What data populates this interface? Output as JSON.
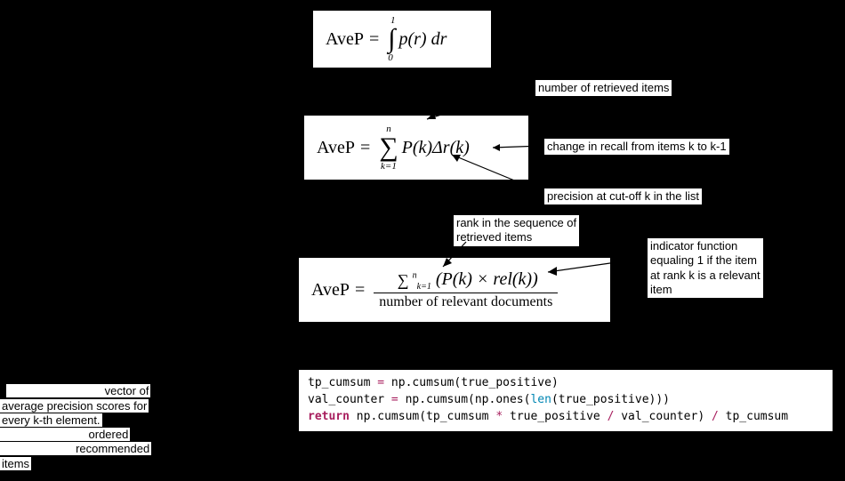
{
  "formulas": {
    "f1_label": "AveP",
    "f1_eq": "=",
    "f1_int_top": "1",
    "f1_int_bot": "0",
    "f1_body": "p(r) dr",
    "f2_label": "AveP",
    "f2_eq": "=",
    "f2_sum_top": "n",
    "f2_sum_bot": "k=1",
    "f2_body": "P(k)Δr(k)",
    "f3_label": "AveP",
    "f3_eq": "=",
    "f3_num_sum_top": "n",
    "f3_num_sum_bot": "k=1",
    "f3_num_rest": "(P(k) × rel(k))",
    "f3_den": "number of relevant documents"
  },
  "annotations": {
    "a1": "number of retrieved items",
    "a2": "change in recall from items k to k-1",
    "a3": "precision at cut-off k in the list",
    "a4": "rank in the sequence of\nretrieved items",
    "a5": "indicator function\nequaling 1 if the item\nat rank k is a relevant\nitem"
  },
  "hidden_text": {
    "left_block": "vector of\naverage precision scores for\nevery k-th element.\nordered\nrecommended\nitems"
  },
  "code": {
    "line1_a": "tp_cumsum ",
    "line1_op": "=",
    "line1_b": " np.cumsum(true_positive)",
    "line2_a": "val_counter ",
    "line2_op": "=",
    "line2_b": " np.cumsum(np.ones(",
    "line2_len": "len",
    "line2_c": "(true_positive)))",
    "line3_ret": "return",
    "line3_a": " np.cumsum(tp_cumsum ",
    "line3_op1": "*",
    "line3_b": " true_positive ",
    "line3_op2": "/",
    "line3_c": " val_counter) ",
    "line3_op3": "/",
    "line3_d": " tp_cumsum"
  }
}
